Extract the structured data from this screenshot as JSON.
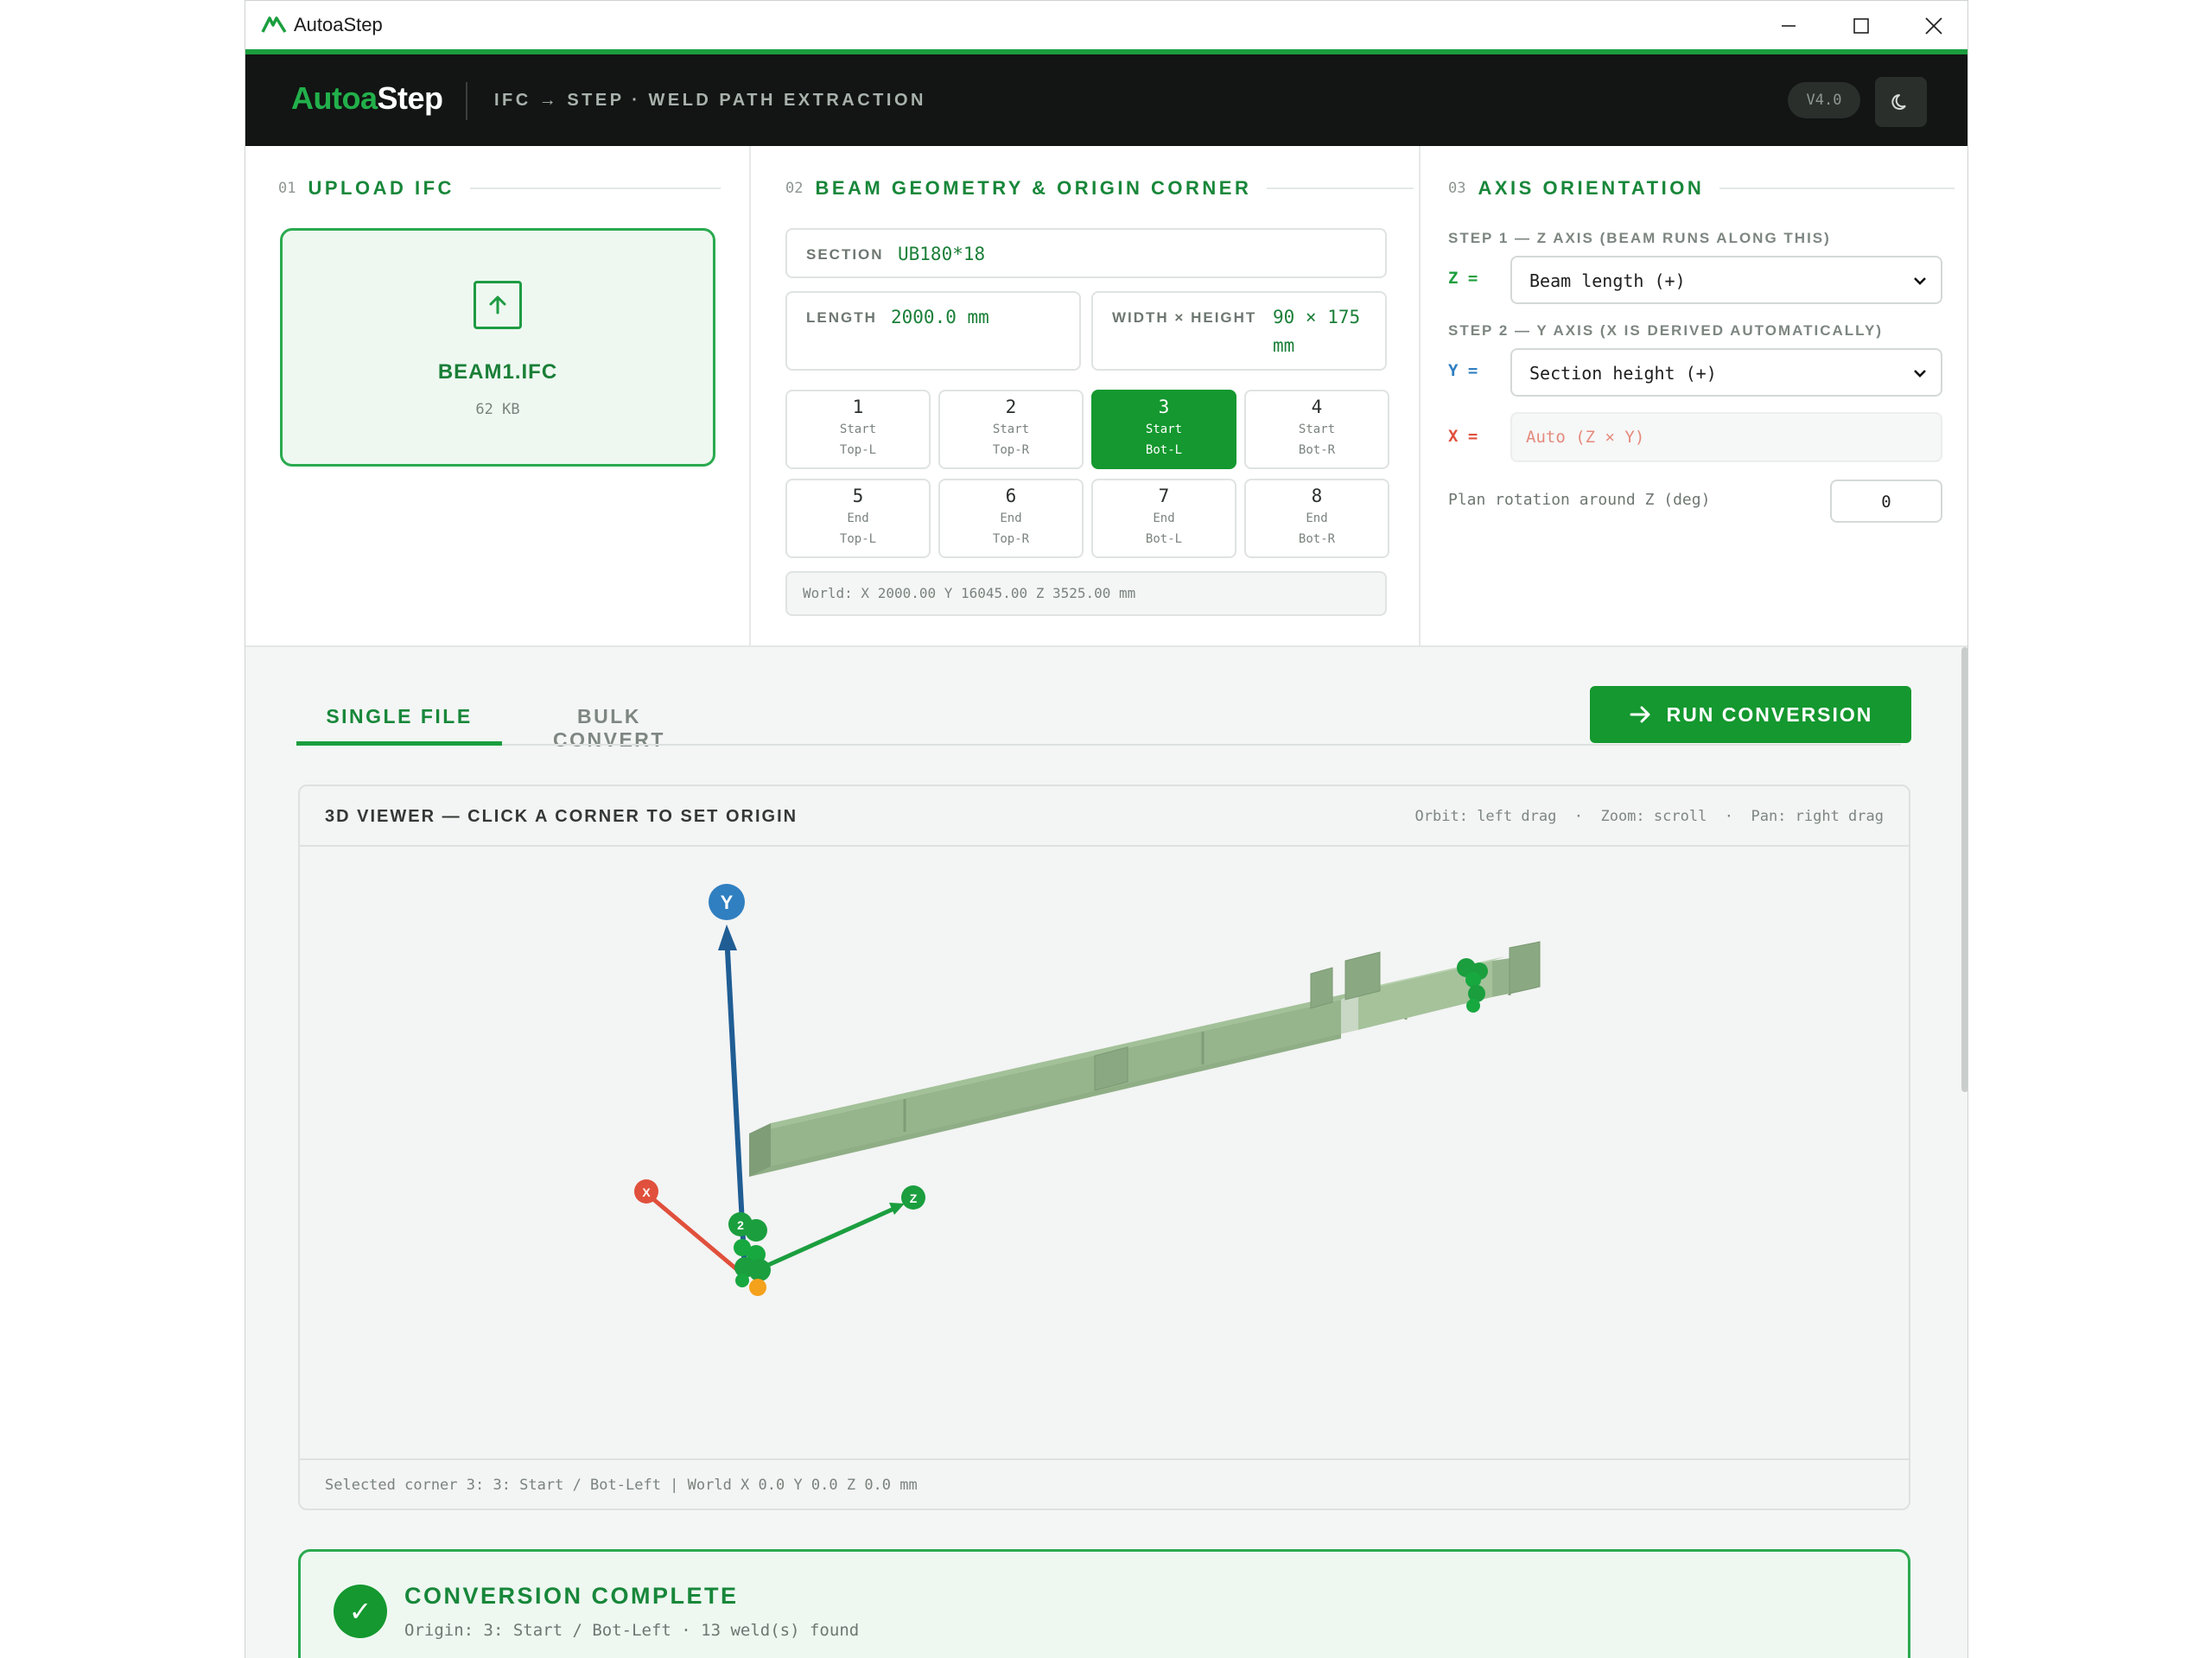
{
  "window": {
    "title": "AutoaStep",
    "minimize": "─",
    "maximize": "☐",
    "close": "✕"
  },
  "header": {
    "brand_part1": "Autoa",
    "brand_part2": "Step",
    "subtitle": "IFC → STEP · WELD PATH EXTRACTION",
    "version": "V4.0",
    "theme_icon": "moon-icon"
  },
  "upload": {
    "number": "01",
    "title": "UPLOAD IFC",
    "file_name": "BEAM1.IFC",
    "file_size": "62 KB",
    "icon": "upload-arrow-icon"
  },
  "geometry": {
    "number": "02",
    "title": "BEAM GEOMETRY & ORIGIN CORNER",
    "section_label": "SECTION",
    "section_value": "UB180*18",
    "length_label": "LENGTH",
    "length_value": "2000.0 mm",
    "wh_label": "WIDTH × HEIGHT",
    "wh_value_1": "90 × 175",
    "wh_value_2": "mm",
    "corners": [
      {
        "num": "1",
        "line1": "Start",
        "line2": "Top-L"
      },
      {
        "num": "2",
        "line1": "Start",
        "line2": "Top-R"
      },
      {
        "num": "3",
        "line1": "Start",
        "line2": "Bot-L"
      },
      {
        "num": "4",
        "line1": "Start",
        "line2": "Bot-R"
      },
      {
        "num": "5",
        "line1": "End",
        "line2": "Top-L"
      },
      {
        "num": "6",
        "line1": "End",
        "line2": "Top-R"
      },
      {
        "num": "7",
        "line1": "End",
        "line2": "Bot-L"
      },
      {
        "num": "8",
        "line1": "End",
        "line2": "Bot-R"
      }
    ],
    "active_corner": "3",
    "world": "World: X 2000.00 Y 16045.00 Z 3525.00 mm"
  },
  "axis": {
    "number": "03",
    "title": "AXIS ORIENTATION",
    "step1_label": "STEP 1 — Z AXIS (BEAM RUNS ALONG THIS)",
    "z_label": "Z =",
    "z_value": "Beam length (+)",
    "step2_label": "STEP 2 — Y AXIS (X IS DERIVED AUTOMATICALLY)",
    "y_label": "Y =",
    "y_value": "Section height (+)",
    "x_label": "X =",
    "x_value": "Auto (Z × Y)",
    "rotation_label": "Plan rotation around Z (deg)",
    "rotation_value": "0",
    "colors": {
      "z": "#1b9e3e",
      "y": "#2f7fc1",
      "x": "#e0503c"
    }
  },
  "tabs": {
    "single": "SINGLE FILE",
    "bulk": "BULK CONVERT",
    "active": "single"
  },
  "run_button": "RUN CONVERSION",
  "viewer": {
    "title": "3D VIEWER — CLICK A CORNER TO SET ORIGIN",
    "hints": "Orbit: left drag  ·  Zoom: scroll  ·  Pan: right drag",
    "axis_y": "Y",
    "axis_x": "X",
    "axis_z": "Z",
    "footer": "Selected corner 3: 3: Start / Bot-Left | World X 0.0 Y 0.0 Z 0.0 mm",
    "marker_2": "2"
  },
  "result": {
    "title": "CONVERSION COMPLETE",
    "subtitle": "Origin: 3: Start / Bot-Left · 13 weld(s) found",
    "check": "✓"
  },
  "theme": {
    "accent": "#1b9e3e",
    "dark": "#121513"
  }
}
